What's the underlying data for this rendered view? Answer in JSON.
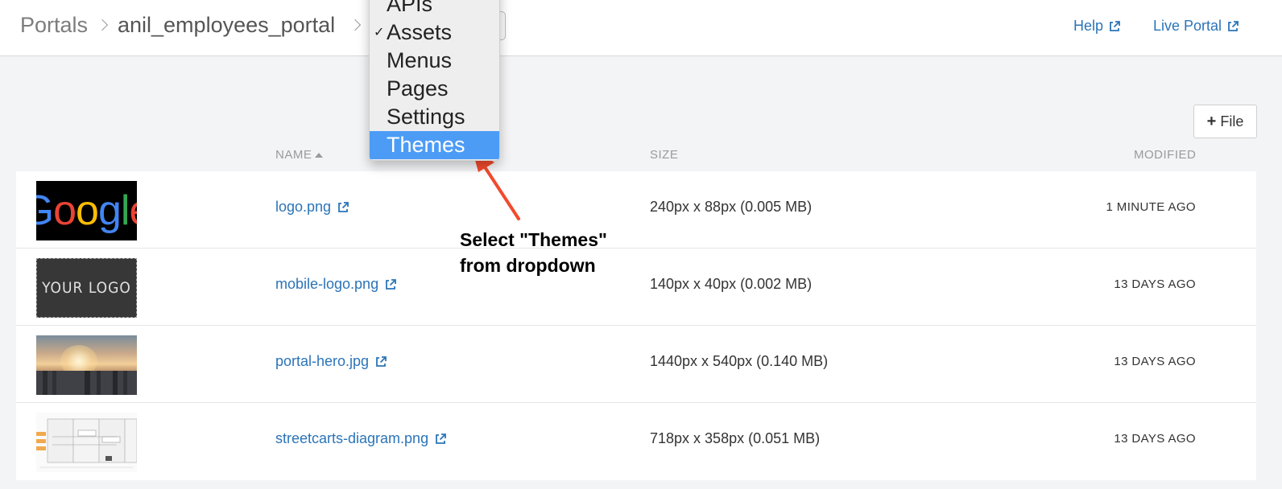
{
  "breadcrumb": {
    "root": "Portals",
    "portal": "anil_employees_portal"
  },
  "header": {
    "help_label": "Help",
    "live_portal_label": "Live Portal"
  },
  "dropdown": {
    "items": [
      {
        "label": "APIs",
        "checked": false,
        "highlighted": false
      },
      {
        "label": "Assets",
        "checked": true,
        "highlighted": false
      },
      {
        "label": "Menus",
        "checked": false,
        "highlighted": false
      },
      {
        "label": "Pages",
        "checked": false,
        "highlighted": false
      },
      {
        "label": "Settings",
        "checked": false,
        "highlighted": false
      },
      {
        "label": "Themes",
        "checked": false,
        "highlighted": true
      }
    ],
    "check_glyph": "✓"
  },
  "toolbar": {
    "add_file_label": "File"
  },
  "table": {
    "columns": {
      "name": "NAME",
      "size": "SIZE",
      "modified": "MODIFIED"
    },
    "rows": [
      {
        "name": "logo.png",
        "size": "240px x 88px (0.005 MB)",
        "modified": "1 MINUTE AGO",
        "thumb": "google-logo"
      },
      {
        "name": "mobile-logo.png",
        "size": "140px x 40px (0.002 MB)",
        "modified": "13 DAYS AGO",
        "thumb": "your-logo"
      },
      {
        "name": "portal-hero.jpg",
        "size": "1440px x 540px (0.140 MB)",
        "modified": "13 DAYS AGO",
        "thumb": "city-hero"
      },
      {
        "name": "streetcarts-diagram.png",
        "size": "718px x 358px (0.051 MB)",
        "modified": "13 DAYS AGO",
        "thumb": "diagram"
      }
    ]
  },
  "thumbnails": {
    "google_text": [
      "G",
      "o",
      "o",
      "g",
      "l",
      "e"
    ],
    "your_logo_text": "YOUR LOGO"
  },
  "annotation": {
    "line1": "Select \"Themes\"",
    "line2": "from dropdown"
  },
  "colors": {
    "link": "#2b74b8",
    "highlight": "#4c9cf6",
    "arrow": "#f24a2c"
  },
  "icons": {
    "external_link": "external-link-icon",
    "plus": "plus-icon",
    "sort": "sort-ascending-icon",
    "breadcrumb_separator": "chevron-right-icon"
  }
}
